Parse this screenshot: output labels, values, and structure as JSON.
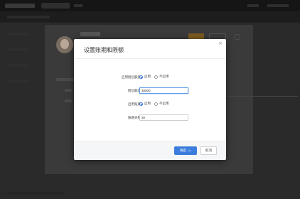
{
  "dialog": {
    "title": "设置账期和限额",
    "close_glyph": "×",
    "fields": [
      {
        "label": "启用授信额度",
        "type": "radio",
        "options": [
          "启用",
          "不启用"
        ],
        "selected": "启用"
      },
      {
        "label": "授信额度",
        "type": "input",
        "value": "30000"
      },
      {
        "label": "启用账期",
        "type": "radio",
        "options": [
          "启用",
          "不启用"
        ],
        "selected": "启用"
      },
      {
        "label": "账期天数",
        "type": "input",
        "value": "30"
      }
    ],
    "confirm_label": "确定",
    "confirm_hint": "(Y)",
    "cancel_label": "取消"
  },
  "colors": {
    "accent": "#3b7ddd",
    "overlay": "#2a2a2a",
    "dialog_bg": "#ffffff"
  },
  "icons": {
    "close": "close-icon",
    "radio_on": "radio-checked-icon",
    "radio_off": "radio-unchecked-icon"
  }
}
